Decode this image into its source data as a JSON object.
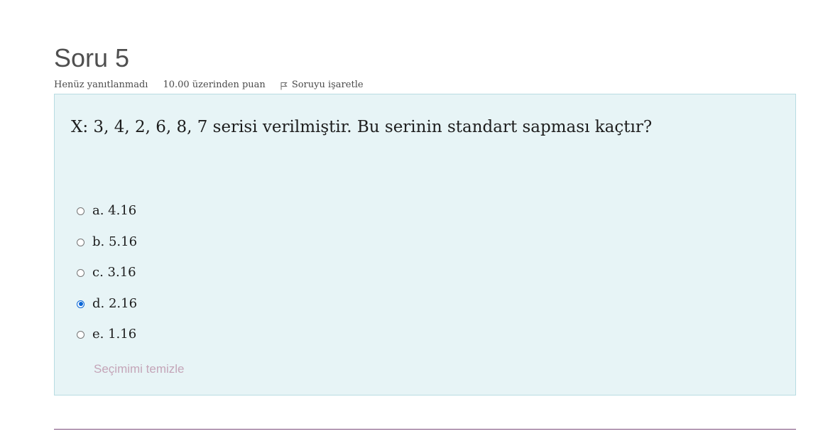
{
  "question": {
    "title": "Soru 5",
    "state": "Henüz yanıtlanmadı",
    "grade": "10.00 üzerinden puan",
    "flag_label": "Soruyu işaretle",
    "flag_icon": "flag-icon",
    "text": "X: 3, 4, 2, 6, 8, 7 serisi verilmiştir. Bu serinin standart sapması kaçtır?",
    "answers": [
      {
        "label": "a. 4.16",
        "selected": false
      },
      {
        "label": "b. 5.16",
        "selected": false
      },
      {
        "label": "c. 3.16",
        "selected": false
      },
      {
        "label": "d. 2.16",
        "selected": true
      },
      {
        "label": "e. 1.16",
        "selected": false
      }
    ],
    "clear_label": "Seçimimi temizle"
  },
  "colors": {
    "box_background": "#e7f4f6",
    "box_border": "#b8dce2",
    "radio_selected": "#0a66d6",
    "clear_link": "#c4a5b8",
    "divider": "#7a4b7a"
  }
}
